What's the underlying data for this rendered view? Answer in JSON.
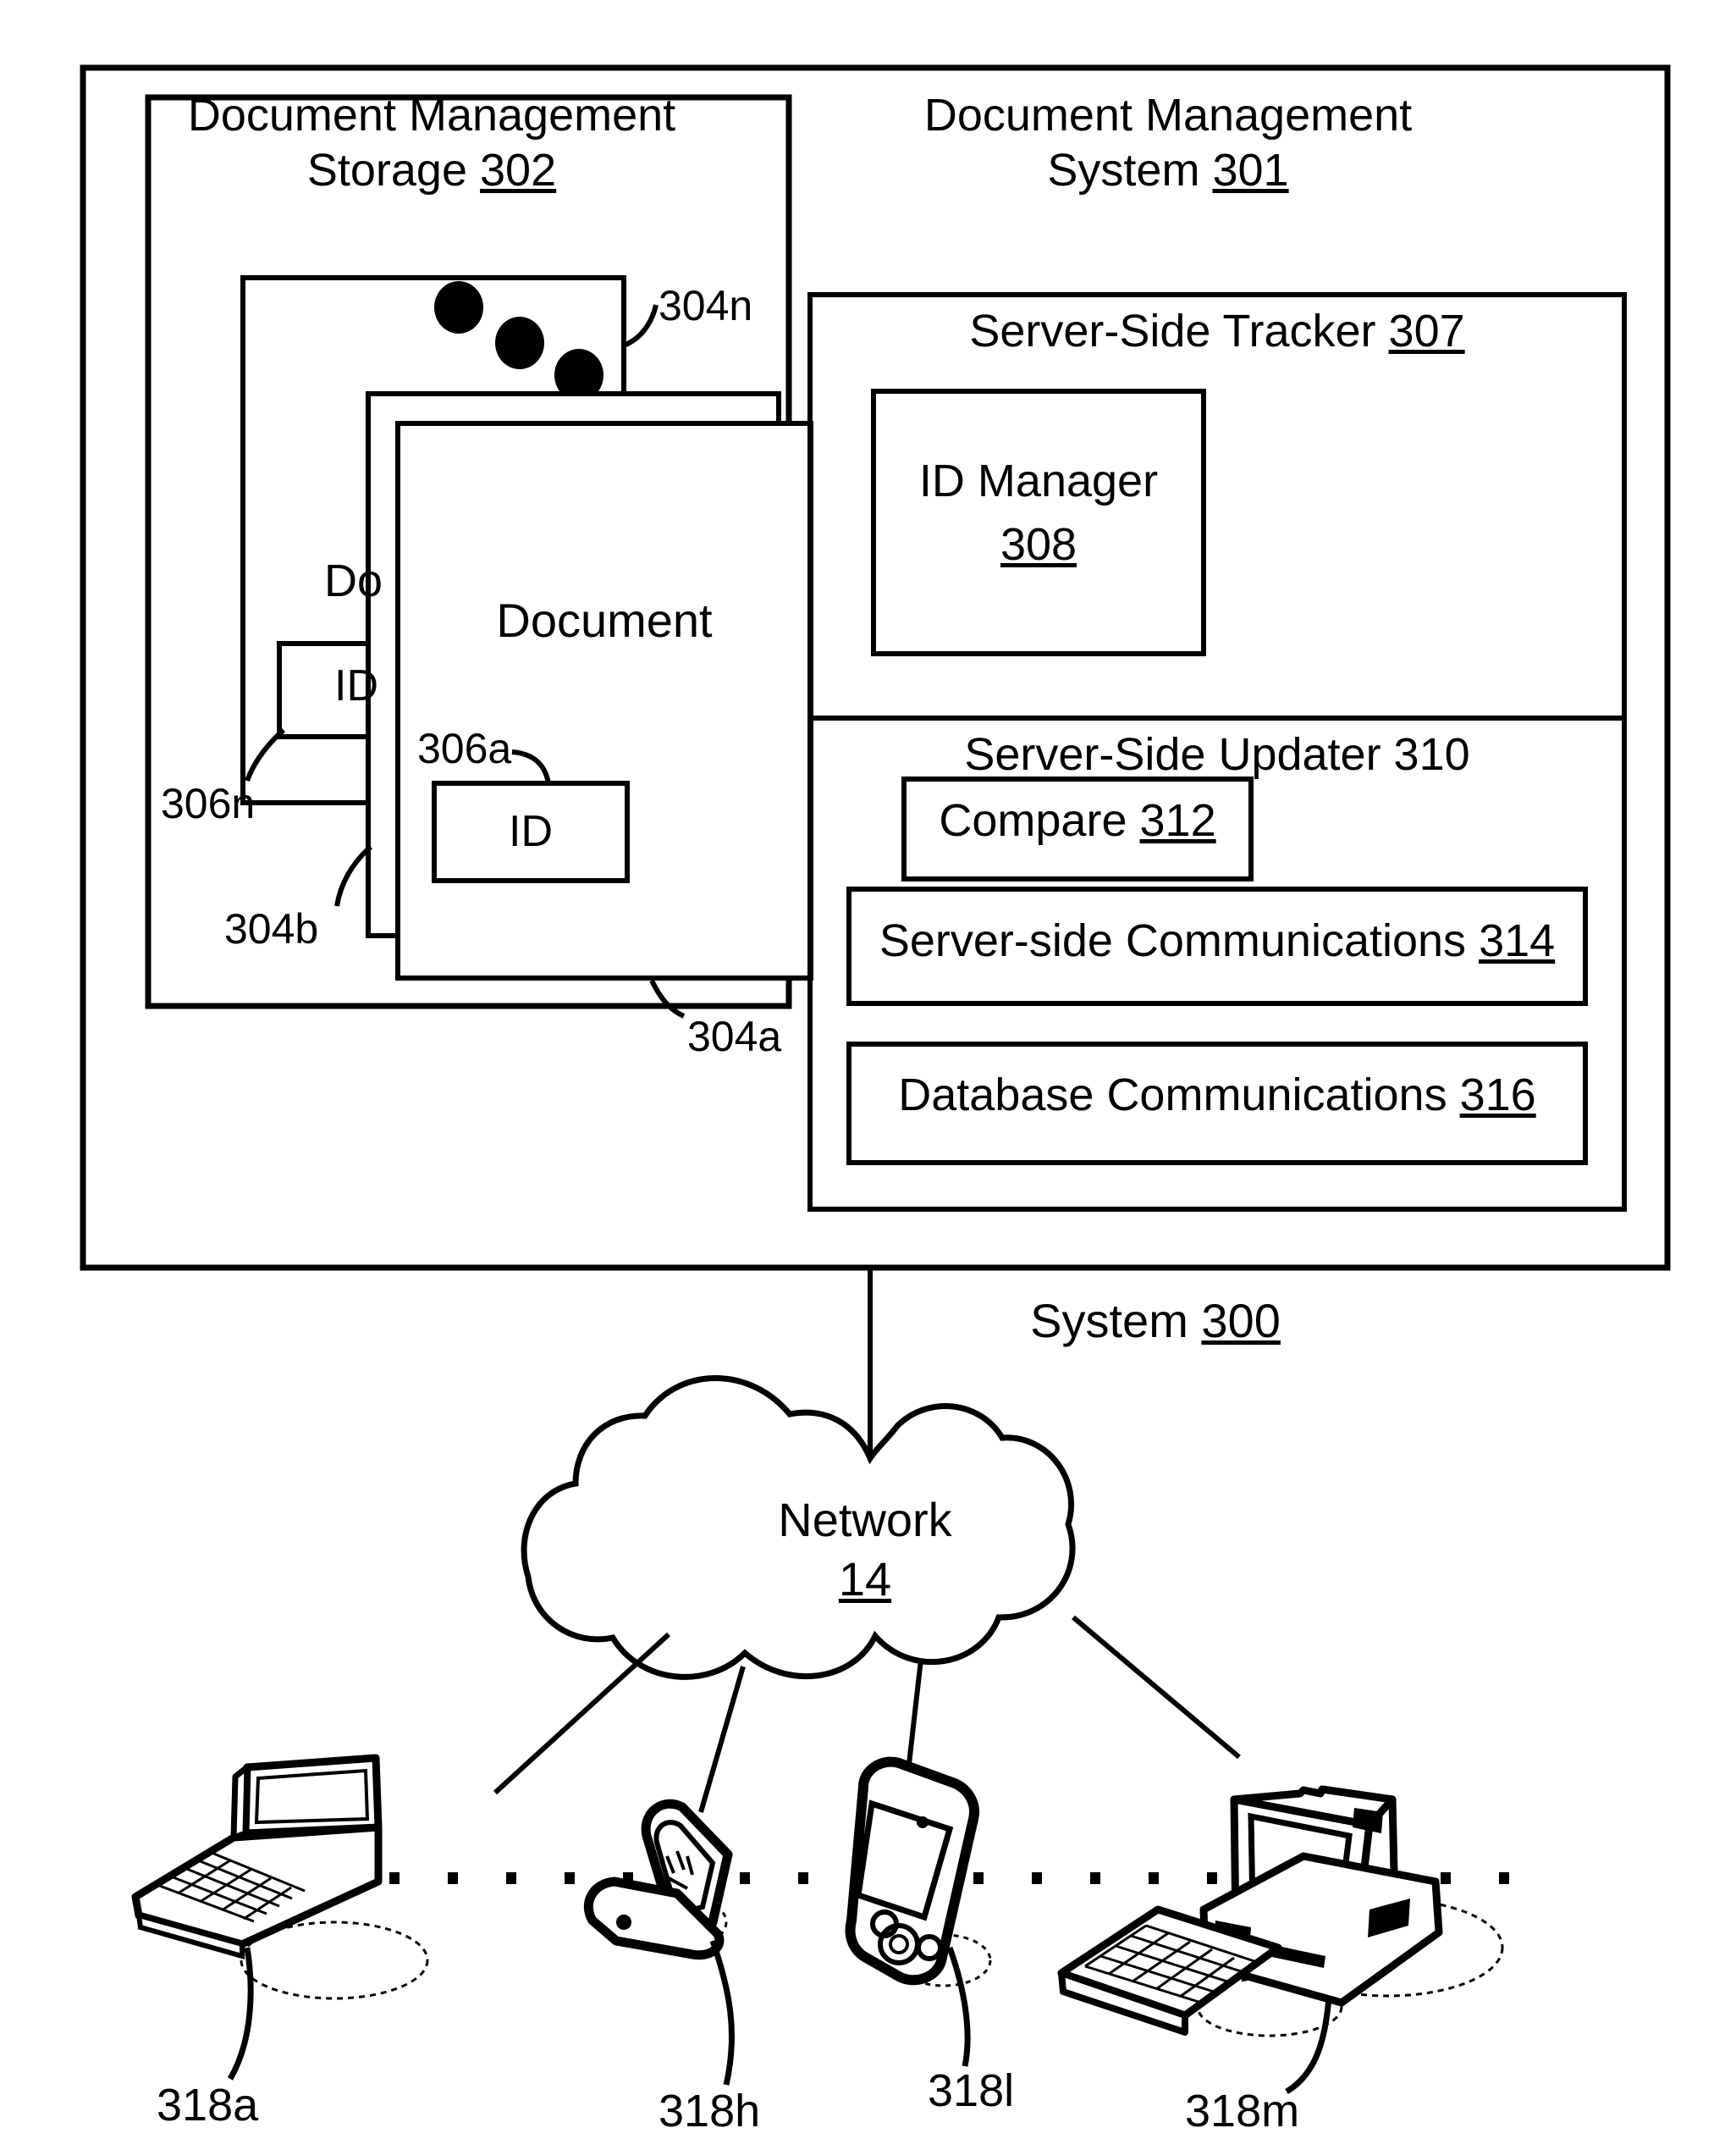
{
  "figure": {
    "type": "patent-diagram",
    "system_label": "System",
    "system_number": "300"
  },
  "storage": {
    "title_line1": "Document Management",
    "title_line2": "Storage",
    "number": "302",
    "documents": [
      {
        "ref": "304n",
        "label": "",
        "id_box_label": "",
        "id_ref": "306n"
      },
      {
        "ref": "304b",
        "label": "Do",
        "id_box_label": "ID",
        "id_ref": ""
      },
      {
        "ref": "304a",
        "label": "Document",
        "id_box_label": "ID",
        "id_ref": "306a"
      }
    ],
    "ref_304n": "304n",
    "ref_304b": "304b",
    "ref_304a": "304a",
    "ref_306n": "306n",
    "ref_306a": "306a",
    "doc_partial_label": "Do",
    "doc_full_label": "Document",
    "id_label_partial": "ID",
    "id_label_full": "ID",
    "ellipsis_dots": 3
  },
  "dms": {
    "title_line1": "Document Management",
    "title_line2": "System",
    "number": "301",
    "tracker": {
      "title": "Server-Side Tracker",
      "number": "307",
      "id_manager": {
        "title": "ID Manager",
        "number": "308"
      }
    },
    "updater": {
      "title": "Server-Side Updater 310",
      "compare": {
        "title": "Compare",
        "number": "312"
      },
      "server_comms": {
        "title": "Server-side Communications",
        "number": "314"
      },
      "db_comms": {
        "title": "Database Communications",
        "number": "316"
      }
    }
  },
  "network": {
    "label": "Network",
    "number": "14"
  },
  "devices": [
    {
      "ref": "318a",
      "icon": "laptop-icon",
      "name": "laptop-device"
    },
    {
      "ref": "318h",
      "icon": "flip-phone-icon",
      "name": "mobile-phone-device"
    },
    {
      "ref": "318l",
      "icon": "pda-icon",
      "name": "pda-device"
    },
    {
      "ref": "318m",
      "icon": "desktop-computer-icon",
      "name": "desktop-computer-device"
    }
  ],
  "colors": {
    "stroke": "#000000",
    "fill": "#ffffff"
  }
}
